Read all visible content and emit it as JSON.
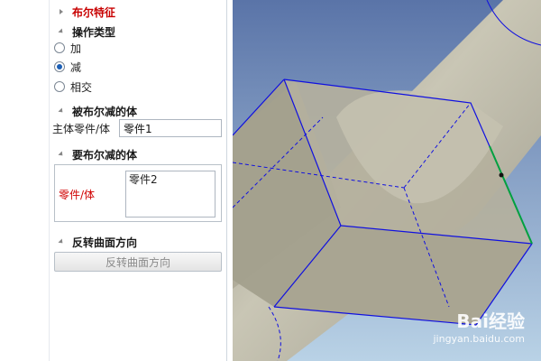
{
  "panel": {
    "title": "布尔特征",
    "operation": {
      "header": "操作类型",
      "options": [
        {
          "label": "加",
          "checked": false
        },
        {
          "label": "减",
          "checked": true
        },
        {
          "label": "相交",
          "checked": false
        }
      ]
    },
    "target": {
      "header": "被布尔减的体",
      "field_label": "主体零件/体",
      "field_value": "零件1"
    },
    "tool": {
      "header": "要布尔减的体",
      "field_label": "零件/体",
      "list_value": "零件2"
    },
    "reverse": {
      "header": "反转曲面方向",
      "button_label": "反转曲面方向"
    }
  },
  "viewport": {
    "background_top": "#5a74a8",
    "background_bottom": "#b9d2e6",
    "solid_color": "#bcb8a6",
    "edge_color": "#1010e0",
    "selected_edge_color": "#00a040"
  },
  "watermark": {
    "brand": "Bai经验",
    "url": "jingyan.baidu.com"
  }
}
